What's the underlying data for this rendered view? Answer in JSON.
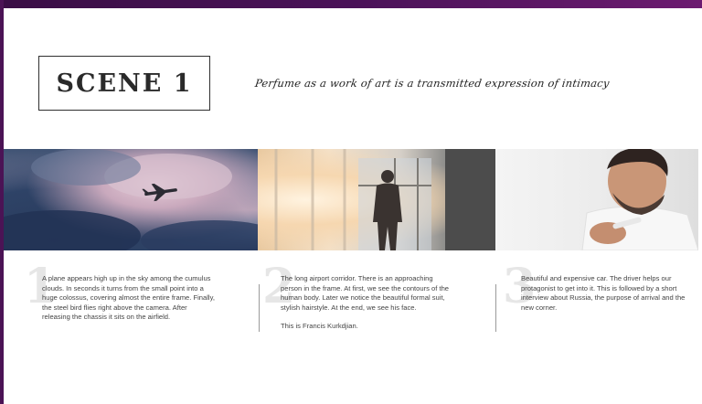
{
  "scene": {
    "title": "SCENE 1"
  },
  "tagline": "Perfume as a work of art is a transmitted expression of intimacy",
  "photos": [
    {
      "name": "plane-in-sky-photo"
    },
    {
      "name": "airport-corridor-photo"
    },
    {
      "name": "man-shaving-photo"
    }
  ],
  "columns": [
    {
      "number": "1",
      "text": "A plane appears high up in the sky among the cumulus clouds. In seconds it turns from the small point into a huge colossus, covering almost the entire frame. Finally, the steel bird flies right above the camera. After releasing the chassis it sits on the airfield."
    },
    {
      "number": "2",
      "text": "The long airport corridor. There is an approaching person in the frame. At first, we see the contours of the human body. Later we notice the beautiful formal suit, stylish hairstyle. At the end, we see his face.",
      "text2": "This is Francis Kurkdjian."
    },
    {
      "number": "3",
      "text": "Beautiful and expensive car. The driver helps our protagonist to get into it. This is followed by a short interview about Russia, the purpose of arrival and the new corner."
    }
  ]
}
